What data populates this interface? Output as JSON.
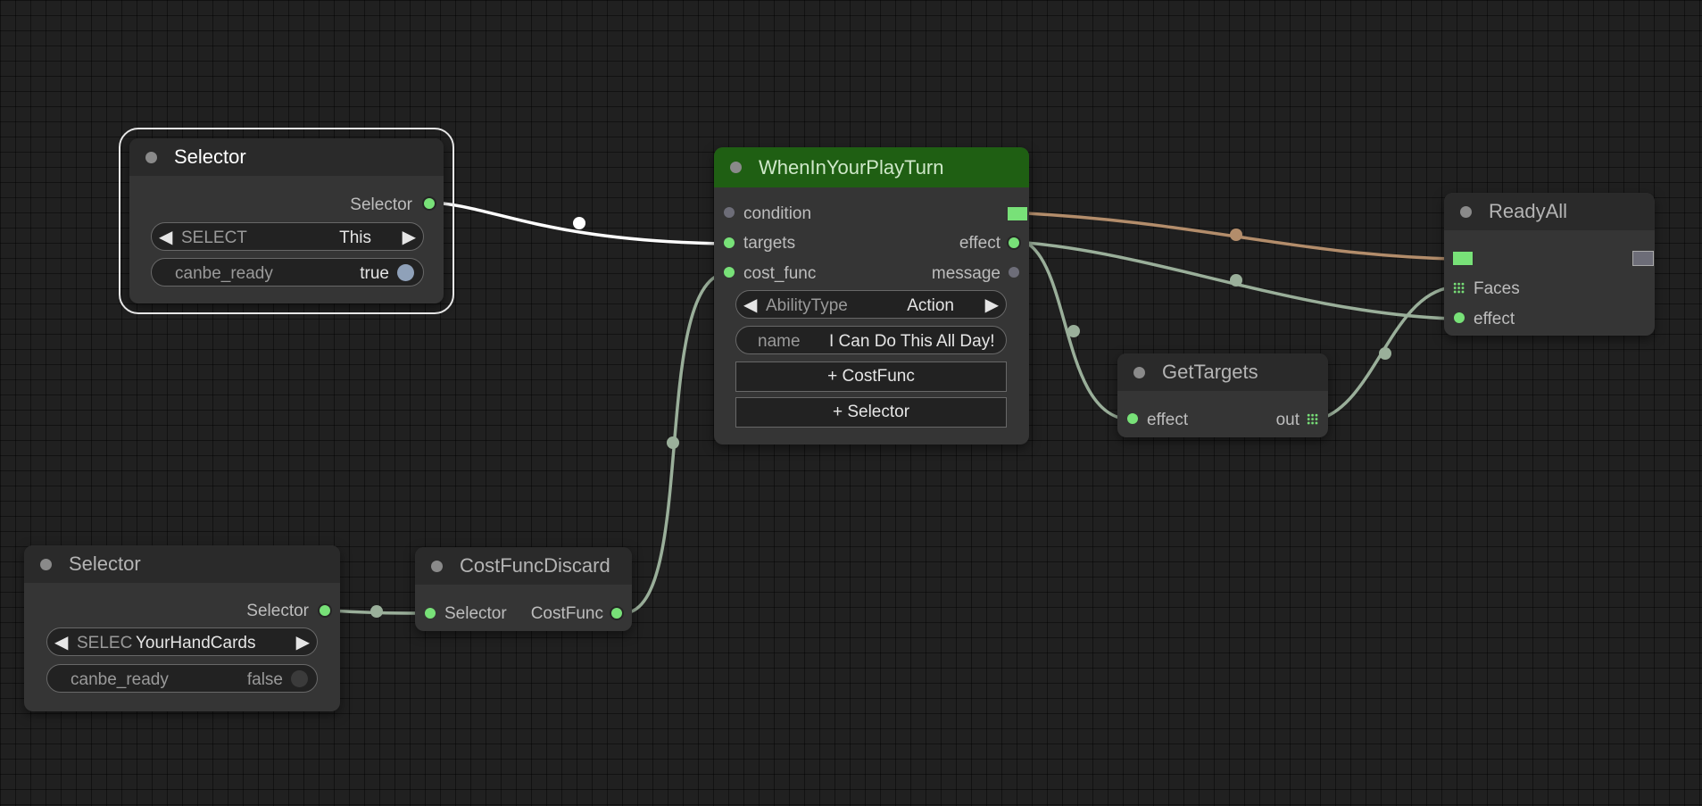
{
  "nodes": {
    "selector_top": {
      "title": "Selector",
      "output": "Selector",
      "select": {
        "label": "SELECT",
        "value": "This"
      },
      "canbe_ready": {
        "label": "canbe_ready",
        "value": "true"
      }
    },
    "when_in_your_play_turn": {
      "title": "WhenInYourPlayTurn",
      "inputs": [
        "condition",
        "targets",
        "cost_func"
      ],
      "outputs": [
        "effect",
        "message"
      ],
      "ability_type": {
        "label": "AbilityType",
        "value": "Action"
      },
      "name": {
        "label": "name",
        "value": "I Can Do This All Day!"
      },
      "add_costfunc": "+ CostFunc",
      "add_selector": "+ Selector"
    },
    "ready_all": {
      "title": "ReadyAll",
      "inputs": [
        "Faces",
        "effect"
      ]
    },
    "get_targets": {
      "title": "GetTargets",
      "input": "effect",
      "output": "out"
    },
    "selector_bottom": {
      "title": "Selector",
      "output": "Selector",
      "select": {
        "label": "SELEC",
        "value": "YourHandCards"
      },
      "canbe_ready": {
        "label": "canbe_ready",
        "value": "false"
      }
    },
    "cost_func_discard": {
      "title": "CostFuncDiscard",
      "input": "Selector",
      "output": "CostFunc"
    }
  },
  "colors": {
    "canvas": "#202020",
    "node_body": "#353535",
    "node_title": "#2a2a2a",
    "event_title": "#1f5f13",
    "slot_green": "#78e178",
    "link_default": "#9aaf9a",
    "link_selected": "#ffffff",
    "link_condition": "#b38d6b"
  },
  "icons": {
    "left_arrow": "◀",
    "right_arrow": "▶"
  }
}
